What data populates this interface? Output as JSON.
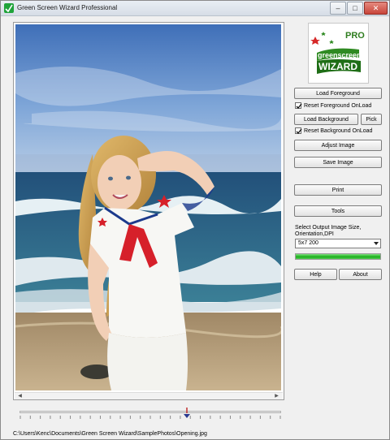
{
  "window": {
    "title": "Green Screen Wizard Professional"
  },
  "controls": {
    "min": "–",
    "max": "□",
    "close": "✕"
  },
  "photo": {
    "alt": "photo of a girl saluting on a beach"
  },
  "logo": {
    "pro": "PRO",
    "line1": "greenscreen",
    "line2": "WIZARD"
  },
  "buttons": {
    "load_foreground": "Load Foreground",
    "load_background": "Load Background",
    "pick": "Pick",
    "adjust_image": "Adjust Image",
    "save_image": "Save Image",
    "print": "Print",
    "tools": "Tools",
    "help": "Help",
    "about": "About"
  },
  "checkboxes": {
    "reset_foreground": {
      "label": "Reset Foreground OnLoad",
      "checked": true
    },
    "reset_background": {
      "label": "Reset Background OnLoad",
      "checked": true
    }
  },
  "output": {
    "label": "Select Output Image Size, Orientation,DPI",
    "selected": "5x7 200"
  },
  "progress": {
    "value": 1.0,
    "color": "#19b019"
  },
  "slider": {
    "value": 0.64
  },
  "status": {
    "path": "C:\\Users\\Kenc\\Documents\\Green Screen Wizard\\SamplePhotos\\Opening.jpg"
  },
  "colors": {
    "accent": "#1fa33a",
    "sky": "#5f8fc9",
    "sea": "#2f6f8f"
  }
}
